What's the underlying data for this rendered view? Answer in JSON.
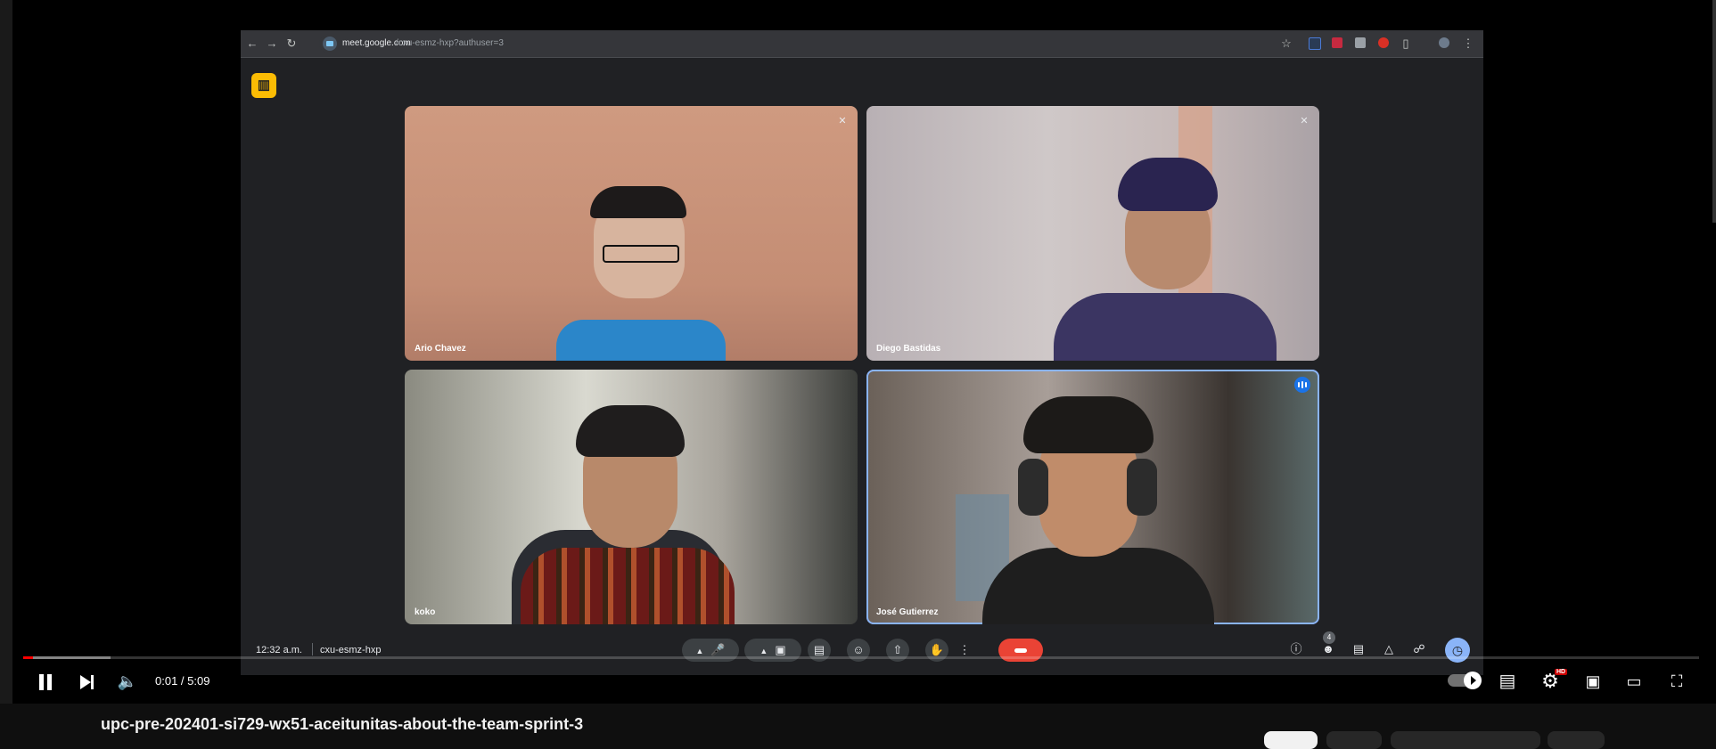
{
  "browser": {
    "url_host": "meet.google.com",
    "url_path": "/cxu-esmz-hxp?authuser=3"
  },
  "meet": {
    "participants": [
      {
        "name": "Ario Chavez",
        "muted": true
      },
      {
        "name": "Diego Bastidas",
        "muted": true
      },
      {
        "name": "koko",
        "muted": false
      },
      {
        "name": "José Gutierrez",
        "muted": false,
        "speaking": true
      }
    ],
    "time": "12:32 a.m.",
    "meeting_code": "cxu-esmz-hxp",
    "people_count": "4"
  },
  "player": {
    "time_display": "0:01 / 5:09",
    "progress_played": 0.006,
    "progress_loaded": 0.052,
    "settings_badge": "HD"
  },
  "video": {
    "title": "upc-pre-202401-si729-wx51-aceitunitas-about-the-team-sprint-3"
  },
  "colors": {
    "hangup": "#ea4335",
    "accent": "#8ab4f8",
    "progress": "#ff0000",
    "lobby_badge": "#fbbc04"
  }
}
